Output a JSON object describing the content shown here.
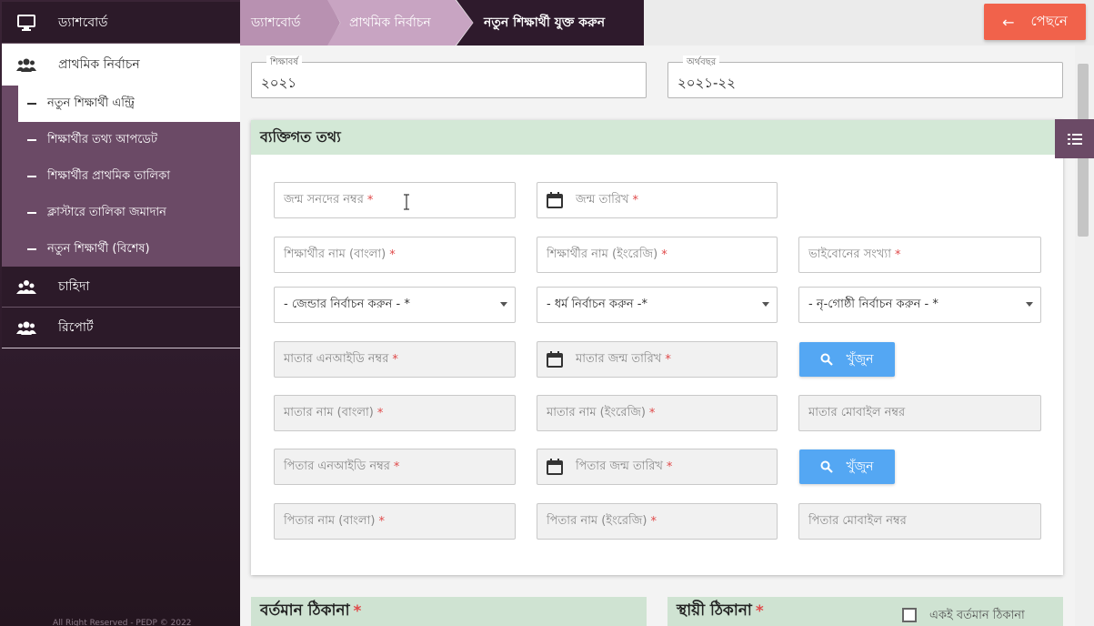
{
  "sidebar": {
    "items": [
      {
        "label": "ড্যাশবোর্ড",
        "icon": "monitor-icon"
      },
      {
        "label": "প্রাথমিক নির্বাচন",
        "icon": "users-icon"
      },
      {
        "label": "চাহিদা",
        "icon": "users-group-icon"
      },
      {
        "label": "রিপোর্ট",
        "icon": "users-icon"
      }
    ],
    "sub_items": [
      {
        "label": "নতুন শিক্ষার্থী এন্ট্রি"
      },
      {
        "label": "শিক্ষার্থীর তথ্য আপডেট"
      },
      {
        "label": "শিক্ষার্থীর প্রাথমিক তালিকা"
      },
      {
        "label": "ক্লাস্টারে তালিকা জমাদান"
      },
      {
        "label": "নতুন শিক্ষার্থী (বিশেষ)"
      }
    ],
    "footer": "All Right Reserved - PEDP © 2022"
  },
  "breadcrumb": [
    "ড্যাশবোর্ড",
    "প্রাথমিক নির্বাচন",
    "নতুন শিক্ষার্থী যুক্ত করুন"
  ],
  "back_button": {
    "label": "পেছনে"
  },
  "top_fields": {
    "academic_year": {
      "label": "শিক্ষাবর্ষ",
      "value": "২০২১"
    },
    "fiscal_year": {
      "label": "অর্থবছর",
      "value": "২০২১-২২"
    }
  },
  "personal": {
    "title": "ব্যক্তিগত তথ্য",
    "birth_reg": "জন্ম সনদের নম্বর",
    "birth_date": "জন্ম তারিখ",
    "name_bn": "শিক্ষার্থীর নাম (বাংলা)",
    "name_en": "শিক্ষার্থীর নাম (ইংরেজি)",
    "siblings": "ভাইবোনের সংখ্যা",
    "gender_select": "- জেন্ডার নির্বাচন করুন - *",
    "religion_select": "- ধর্ম নির্বাচন করুন -*",
    "ethnic_select": "- নৃ-গোষ্ঠী নির্বাচন করুন - *",
    "mother_nid": "মাতার এনআইডি নম্বর",
    "mother_dob": "মাতার জন্ম তারিখ",
    "search_label": "খুঁজুন",
    "mother_name_bn": "মাতার নাম (বাংলা)",
    "mother_name_en": "মাতার নাম (ইংরেজি)",
    "mother_mobile": "মাতার মোবাইল নম্বর",
    "father_nid": "পিতার এনআইডি নম্বর",
    "father_dob": "পিতার জন্ম তারিখ",
    "father_name_bn": "পিতার নাম (বাংলা)",
    "father_name_en": "পিতার নাম (ইংরেজি)",
    "father_mobile": "পিতার মোবাইল নম্বর",
    "required_mark": "*"
  },
  "address": {
    "present": "বর্তমান ঠিকানা",
    "permanent": "স্থায়ী ঠিকানা",
    "same_as_present": "একই বর্তমান ঠিকানা"
  },
  "colors": {
    "sidebar": "#2e1b2b",
    "submenu": "#6b4a66",
    "header_green": "#d3e8d6",
    "back_button": "#f1624b",
    "search_button": "#54a7f3",
    "required": "#e04a4a"
  }
}
